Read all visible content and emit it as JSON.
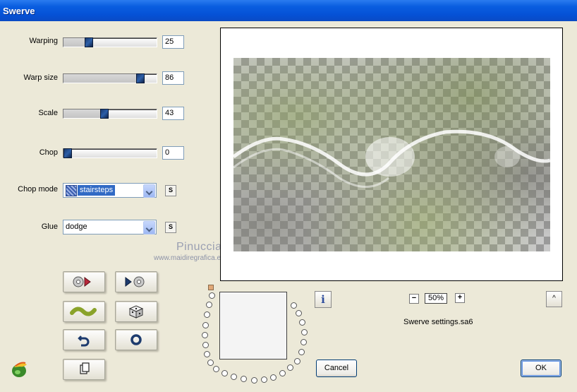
{
  "window": {
    "title": "Swerve"
  },
  "controls": {
    "warping": {
      "label": "Warping",
      "value": "25",
      "percent": 25
    },
    "warp_size": {
      "label": "Warp size",
      "value": "86",
      "percent": 86
    },
    "scale": {
      "label": "Scale",
      "value": "43",
      "percent": 43
    },
    "chop": {
      "label": "Chop",
      "value": "0",
      "percent": 0
    },
    "chop_mode": {
      "label": "Chop mode",
      "value": "stairsteps"
    },
    "glue": {
      "label": "Glue",
      "value": "dodge"
    },
    "setting_button_label": "S"
  },
  "watermark": {
    "name": "Pinuccia",
    "url": "www.maidiregrafica.eu"
  },
  "zoom": {
    "value": "50%",
    "minus": "−",
    "plus": "+"
  },
  "info_button": "i",
  "up_button": "^",
  "settings_file": "Swerve settings.sa6",
  "buttons": {
    "cancel": "Cancel",
    "ok": "OK"
  },
  "colors": {
    "title_bar": "#0a5ee0",
    "dialog_bg": "#ece9d8",
    "thumb": "#1d3b6e"
  }
}
